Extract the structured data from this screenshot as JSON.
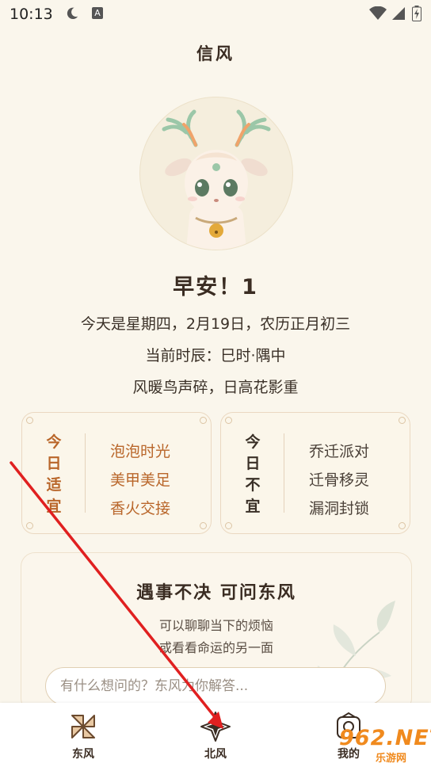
{
  "status_bar": {
    "time": "10:13",
    "icons": [
      "moon-icon",
      "a-icon",
      "wifi-icon",
      "signal-icon",
      "battery-icon"
    ],
    "a_label": "A"
  },
  "header": {
    "title": "信风"
  },
  "greeting": "早安！1",
  "info": {
    "date_line": "今天是星期四，2月19日，农历正月初三",
    "shichen_line": "当前时辰：巳时·隅中",
    "poem_line": "风暖鸟声碎，日高花影重"
  },
  "suitable": {
    "heading": [
      "今",
      "日",
      "适",
      "宜"
    ],
    "items": [
      "泡泡时光",
      "美甲美足",
      "香火交接"
    ],
    "color": "#b9662a"
  },
  "avoid": {
    "heading": [
      "今",
      "日",
      "不",
      "宜"
    ],
    "items": [
      "乔迁派对",
      "迁骨移灵",
      "漏洞封锁"
    ]
  },
  "ask": {
    "title": "遇事不决 可问东风",
    "subtitle1": "可以聊聊当下的烦恼",
    "subtitle2": "或看看命运的另一面",
    "placeholder": "有什么想问的？东风为你解答..."
  },
  "tabs": [
    {
      "label": "东风",
      "icon": "pinwheel-icon"
    },
    {
      "label": "北风",
      "icon": "star-icon"
    },
    {
      "label": "我的",
      "icon": "profile-icon"
    }
  ],
  "watermark": {
    "text": "962.NET",
    "sub": "乐游网"
  },
  "colors": {
    "background": "#faf6ec",
    "accent": "#b9662a",
    "annotation_arrow": "#e02020"
  }
}
